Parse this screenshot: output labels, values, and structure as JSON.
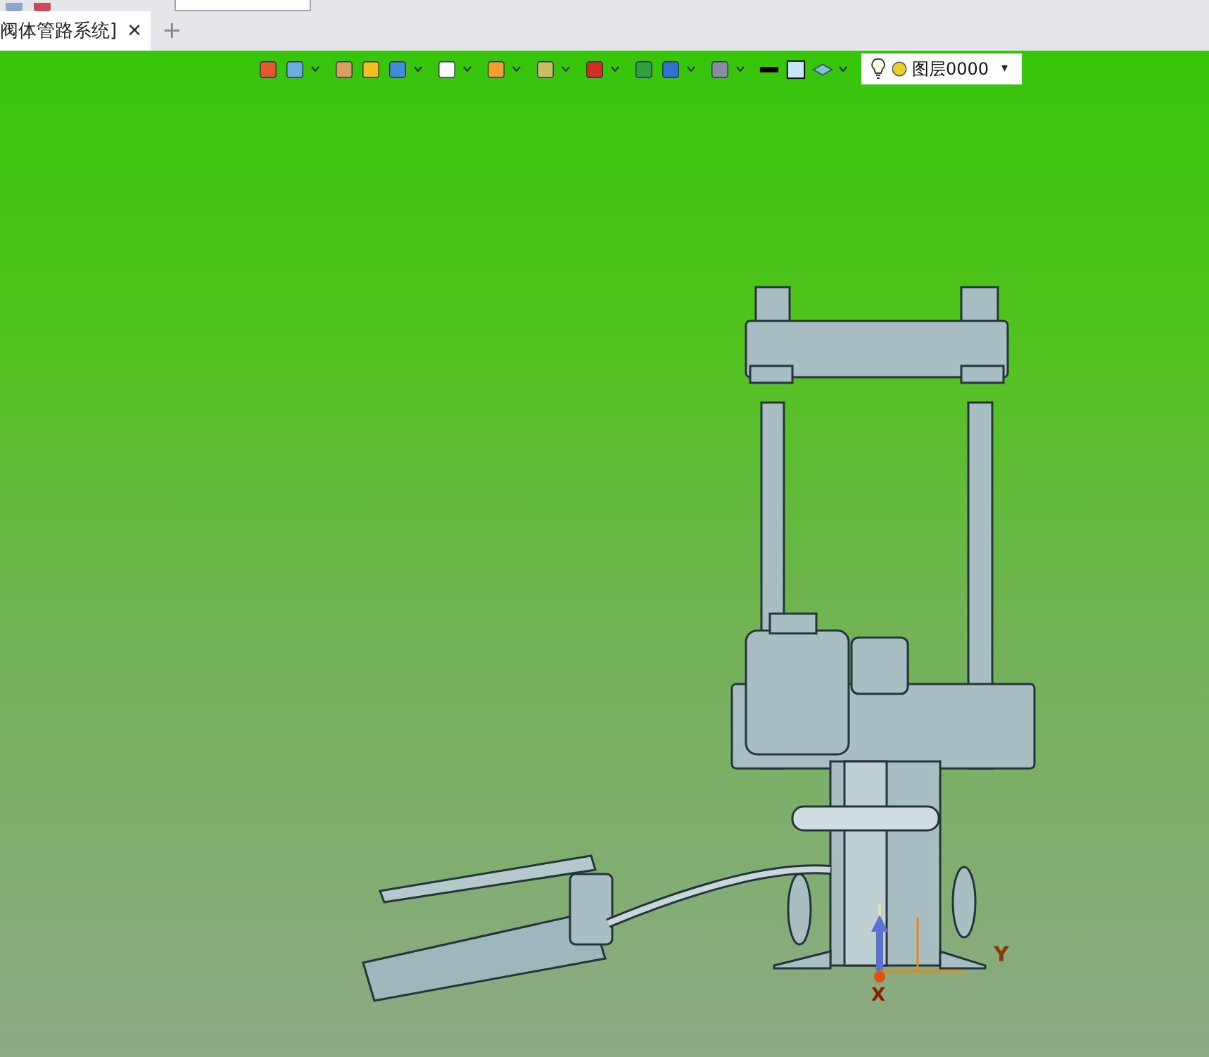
{
  "tab": {
    "title": "阀体管路系统]",
    "close": "✕",
    "add": "+"
  },
  "view_toolbar": {
    "layer": {
      "name": "图层0000",
      "caret": "▾"
    }
  },
  "axes": {
    "x": "X",
    "y": "Y"
  }
}
